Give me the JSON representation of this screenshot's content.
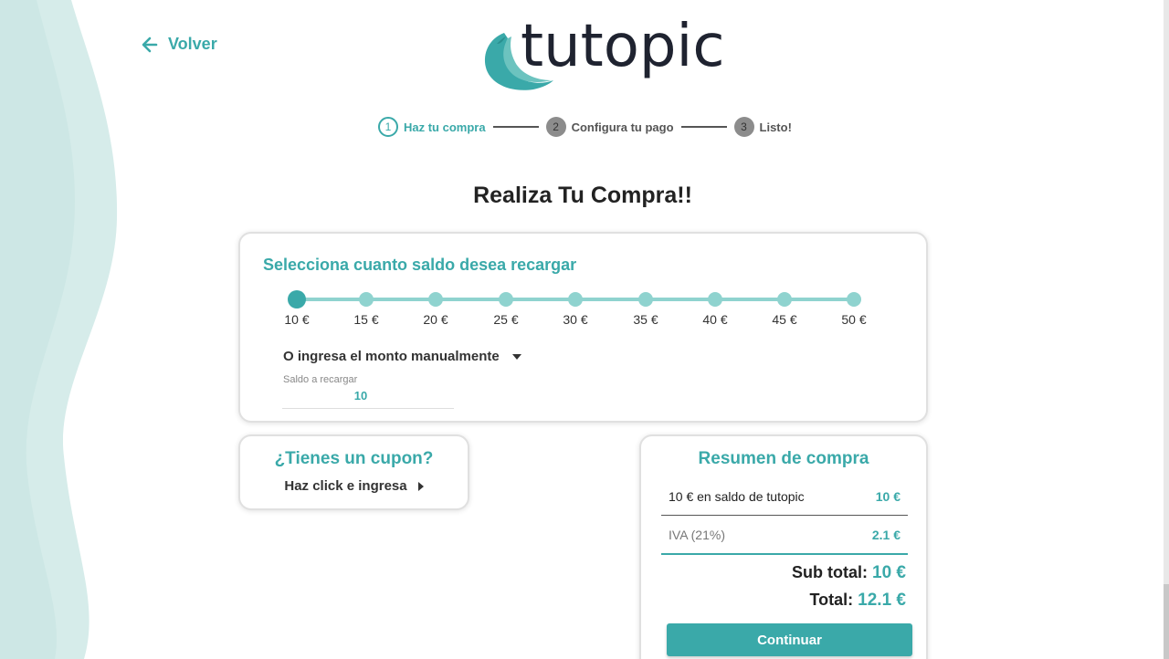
{
  "colors": {
    "accent": "#3aa9a9",
    "accent_light": "#8fd3cf",
    "background_wave": "#d6ecea"
  },
  "header": {
    "back_label": "Volver",
    "back_icon": "arrow-left-icon",
    "logo_text": "tutopic",
    "logo_icon": "feather-icon"
  },
  "stepper": {
    "steps": [
      {
        "number": "1",
        "label": "Haz tu compra",
        "state": "active"
      },
      {
        "number": "2",
        "label": "Configura tu pago",
        "state": "inactive"
      },
      {
        "number": "3",
        "label": "Listo!",
        "state": "inactive"
      }
    ]
  },
  "page_title": "Realiza Tu Compra!!",
  "amount_card": {
    "heading": "Selecciona cuanto saldo desea recargar",
    "slider": {
      "options": [
        "10 €",
        "15 €",
        "20 €",
        "25 €",
        "30 €",
        "35 €",
        "40 €",
        "45 €",
        "50 €"
      ],
      "selected_index": 0
    },
    "manual_toggle_label": "O ingresa el monto manualmente",
    "manual_input": {
      "label": "Saldo a recargar",
      "value": "10"
    }
  },
  "coupon_card": {
    "title": "¿Tienes un cupon?",
    "link_label": "Haz click e ingresa"
  },
  "summary_card": {
    "title": "Resumen de compra",
    "rows": [
      {
        "label": "10 € en saldo de tutopic",
        "value": "10 €"
      },
      {
        "label": "IVA (21%)",
        "value": "2.1 €"
      }
    ],
    "subtotal_label": "Sub total:",
    "subtotal_value": "10 €",
    "total_label": "Total:",
    "total_value": "12.1 €",
    "continue_label": "Continuar"
  }
}
